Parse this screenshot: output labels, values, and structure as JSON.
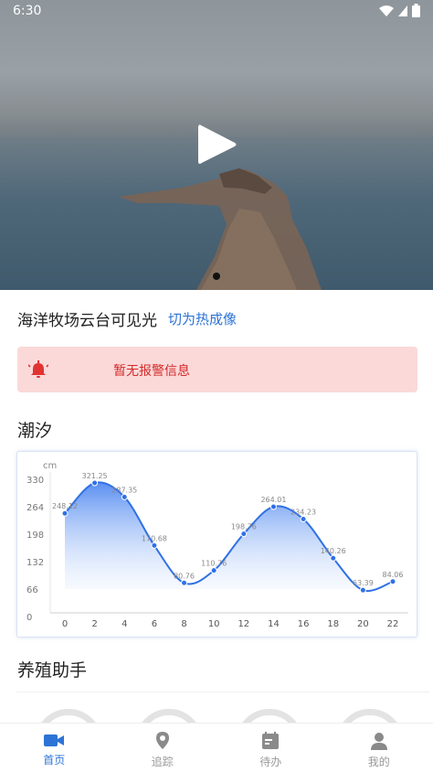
{
  "status_bar": {
    "time": "6:30"
  },
  "camera": {
    "title": "海洋牧场云台可见光",
    "switch_label": "切为热成像"
  },
  "alarm": {
    "message": "暂无报警信息"
  },
  "tide": {
    "section_title": "潮汐"
  },
  "assistant": {
    "section_title": "养殖助手"
  },
  "colors": {
    "accent": "#2d73d6",
    "alarm_bg": "#fbd9d9",
    "alarm_text": "#d42a2a"
  },
  "chart_data": {
    "type": "area",
    "unit_label": "cm",
    "x": [
      0,
      2,
      4,
      6,
      8,
      10,
      12,
      14,
      16,
      18,
      20,
      22
    ],
    "y": [
      248.12,
      321.25,
      287.35,
      170.68,
      80.76,
      110.76,
      198.76,
      264.01,
      234.23,
      140.26,
      63.39,
      84.06
    ],
    "point_labels": [
      "248.12",
      "321.25",
      "287.35",
      "170.68",
      "80.76",
      "110.76",
      "198.76",
      "264.01",
      "234.23",
      "140.26",
      "63.39",
      "84.06"
    ],
    "y_ticks": [
      "0",
      "66",
      "132",
      "198",
      "264",
      "330"
    ],
    "x_ticks": [
      "0",
      "2",
      "4",
      "6",
      "8",
      "10",
      "12",
      "14",
      "16",
      "18",
      "20",
      "22"
    ],
    "ylim": [
      0,
      330
    ]
  },
  "nav": [
    {
      "label": "首页",
      "icon": "video-camera-icon",
      "active": true
    },
    {
      "label": "追踪",
      "icon": "location-pin-icon",
      "active": false
    },
    {
      "label": "待办",
      "icon": "calendar-todo-icon",
      "active": false
    },
    {
      "label": "我的",
      "icon": "person-icon",
      "active": false
    }
  ]
}
